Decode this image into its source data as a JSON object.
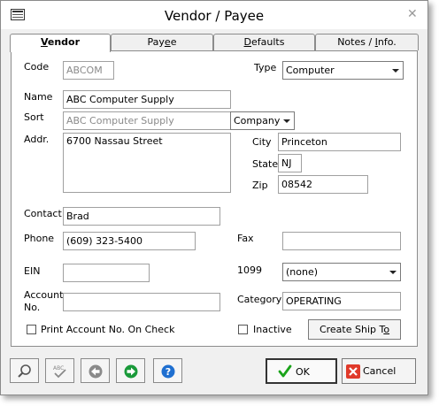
{
  "window": {
    "title": "Vendor / Payee"
  },
  "tabs": [
    {
      "pre": "",
      "key": "V",
      "post": "endor"
    },
    {
      "pre": "Pay",
      "key": "e",
      "post": "e"
    },
    {
      "pre": "",
      "key": "D",
      "post": "efaults"
    },
    {
      "pre": "Notes / ",
      "key": "I",
      "post": "nfo."
    }
  ],
  "form": {
    "code_label": "Code",
    "code_value": "ABCOM",
    "type_label": "Type",
    "type_value": "Computer",
    "name_label": "Name",
    "name_value": "ABC Computer Supply",
    "sort_label": "Sort",
    "sort_value": "ABC Computer Supply",
    "sort_type_value": "Company",
    "addr_label": "Addr.",
    "addr_value": "6700 Nassau Street",
    "city_label": "City",
    "city_value": "Princeton",
    "state_label": "State",
    "state_value": "NJ",
    "zip_label": "Zip",
    "zip_value": "08542",
    "contact_label": "Contact",
    "contact_value": "Brad",
    "phone_label": "Phone",
    "phone_value": "(609) 323-5400",
    "fax_label": "Fax",
    "fax_value": "",
    "ein_label": "EIN",
    "ein_value": "",
    "form1099_label": "1099",
    "form1099_value": "(none)",
    "account_label_1": "Account",
    "account_label_2": "No.",
    "account_value": "",
    "category_label": "Category",
    "category_value": "OPERATING",
    "print_account_label": "Print Account No. On Check",
    "inactive_label": "Inactive",
    "ship_to_pre": "Create Ship T",
    "ship_to_key": "o",
    "ship_to_post": ""
  },
  "footer": {
    "ok_label": "OK",
    "cancel_label": "Cancel",
    "icons": [
      "search-icon",
      "spellcheck-icon",
      "back-icon",
      "forward-icon",
      "help-icon"
    ]
  },
  "colors": {
    "ok_check": "#1aa31a",
    "cancel_x": "#e03a2a",
    "forward": "#1a9a3a",
    "help": "#1f6fd0"
  }
}
